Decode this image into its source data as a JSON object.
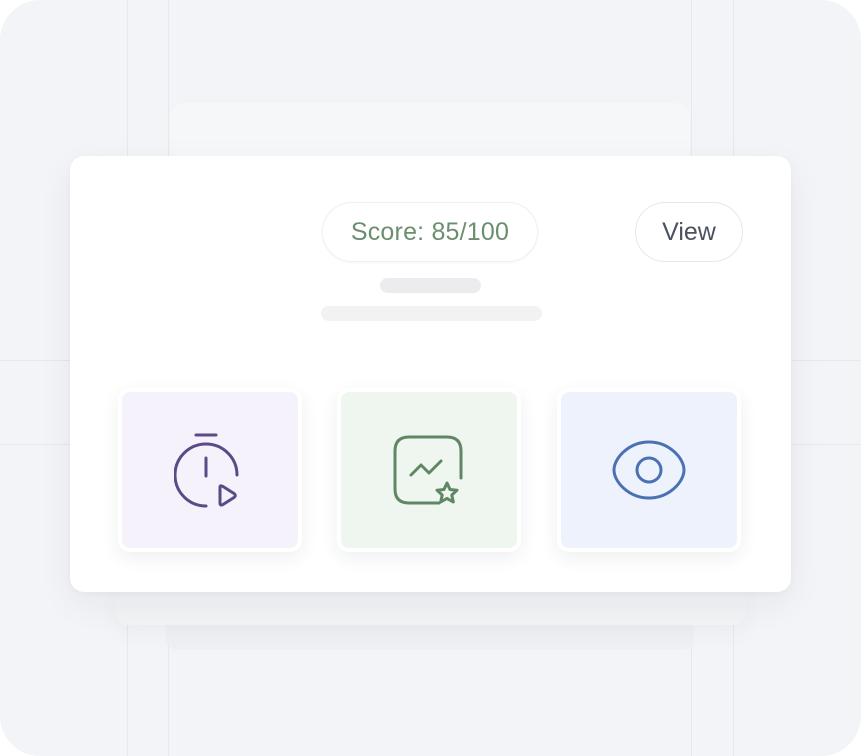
{
  "score": {
    "label": "Score: 85/100",
    "color": "#6b8e6f"
  },
  "view_button": {
    "label": "View"
  },
  "tiles": [
    {
      "icon": "timer-play-icon",
      "color": "#5a4a86",
      "background": "#f5f2fb"
    },
    {
      "icon": "chart-star-icon",
      "color": "#5f8765",
      "background": "#eff6ef"
    },
    {
      "icon": "eye-icon",
      "color": "#4a72b3",
      "background": "#eef2fd"
    }
  ]
}
